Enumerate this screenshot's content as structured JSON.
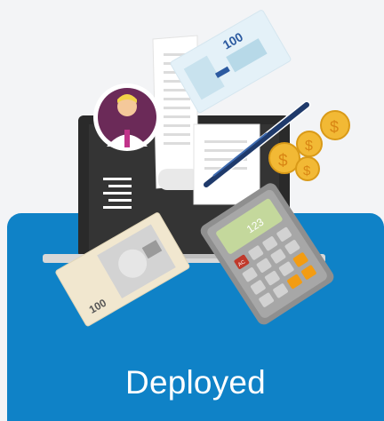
{
  "card": {
    "label": "Deployed"
  },
  "illustration": {
    "banknote_top_label": "100",
    "banknote_bottom_label": "100",
    "calculator_display": "123",
    "calculator_key_clear": "AC",
    "coin_symbol": "$"
  },
  "colors": {
    "card_background": "#0f82c7",
    "page_background": "#f3f4f6",
    "laptop_body": "#2a2a2a",
    "avatar_circle": "#6b2a58",
    "coin_gold": "#f2b935"
  }
}
